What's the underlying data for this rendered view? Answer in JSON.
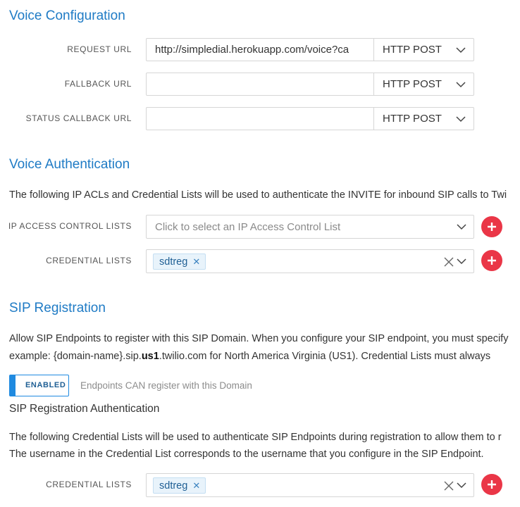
{
  "voice_configuration": {
    "title": "Voice Configuration",
    "rows": [
      {
        "label": "REQUEST URL",
        "value": "http://simpledial.herokuapp.com/voice?ca",
        "method": "HTTP POST"
      },
      {
        "label": "FALLBACK URL",
        "value": "",
        "method": "HTTP POST"
      },
      {
        "label": "STATUS CALLBACK URL",
        "value": "",
        "method": "HTTP POST"
      }
    ]
  },
  "voice_authentication": {
    "title": "Voice Authentication",
    "description": "The following IP ACLs and Credential Lists will be used to authenticate the INVITE for inbound SIP calls to Twi",
    "ip_acl": {
      "label": "IP ACCESS CONTROL LISTS",
      "placeholder": "Click to select an IP Access Control List"
    },
    "credential_lists": {
      "label": "CREDENTIAL LISTS",
      "tag": "sdtreg"
    }
  },
  "sip_registration": {
    "title": "SIP Registration",
    "description_line1": "Allow SIP Endpoints to register with this SIP Domain. When you configure your SIP endpoint, you must specify",
    "description_line2_pre": "example: {domain-name}.sip.",
    "description_line2_bold": "us1",
    "description_line2_post": ".twilio.com for North America Virginia (US1). Credential Lists must always",
    "toggle_label": "ENABLED",
    "toggle_description": "Endpoints CAN register with this Domain",
    "auth_title": "SIP Registration Authentication",
    "auth_description_line1": "The following Credential Lists will be used to authenticate SIP Endpoints during registration to allow them to r",
    "auth_description_line2": "The username in the Credential List corresponds to the username that you configure in the SIP Endpoint.",
    "credential_lists": {
      "label": "CREDENTIAL LISTS",
      "tag": "sdtreg"
    }
  },
  "icons": {
    "chevron": "chevron-down-icon",
    "clear": "clear-icon",
    "remove_tag": "remove-tag-icon",
    "add": "plus-icon"
  },
  "colors": {
    "accent": "#1f7bc5",
    "add_button": "#ea3647",
    "toggle": "#1f8ae0"
  }
}
